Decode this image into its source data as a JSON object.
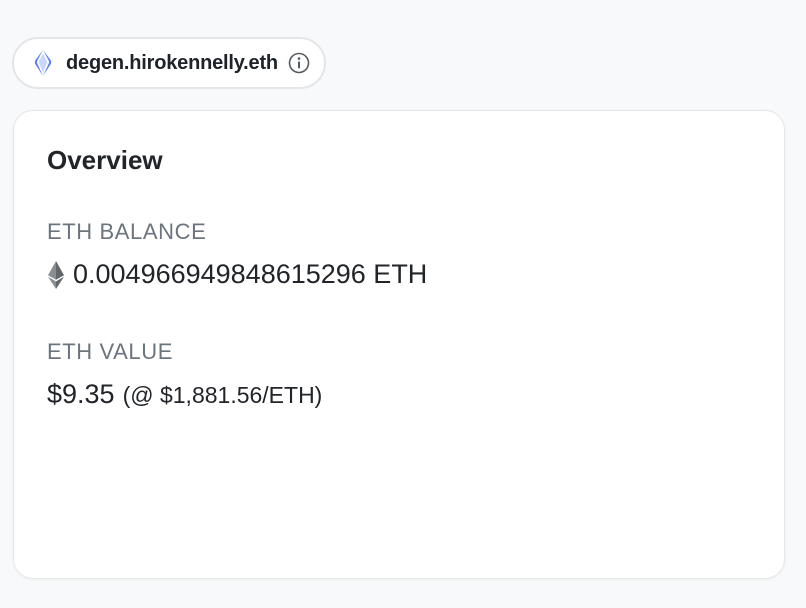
{
  "ens": {
    "name": "degen.hirokennelly.eth",
    "icon": "ens-logo-icon",
    "info_icon": "info-icon",
    "accent_color": "#5b7ef5"
  },
  "overview": {
    "title": "Overview",
    "eth_balance": {
      "label": "ETH BALANCE",
      "icon": "ethereum-icon",
      "value": "0.004966949848615296 ETH"
    },
    "eth_value": {
      "label": "ETH VALUE",
      "usd": "$9.35",
      "rate": "(@ $1,881.56/ETH)"
    }
  }
}
